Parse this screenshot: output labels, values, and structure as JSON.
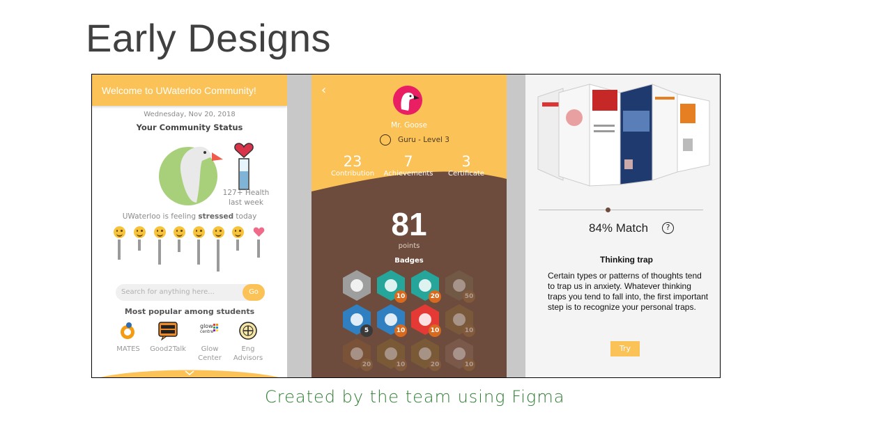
{
  "slide": {
    "title": "Early Designs",
    "caption": "Created by the team using Figma"
  },
  "community": {
    "header": "Welcome to UWaterloo Community!",
    "date": "Wednesday, Nov 20, 2018",
    "status_title": "Your Community Status",
    "health_line1": "127+ Health",
    "health_line2": "last week",
    "feeling_prefix": "UWaterloo is feeling ",
    "feeling_word": "stressed",
    "feeling_suffix": " today",
    "moods": [
      {
        "icon": "smile-emoji-icon",
        "level": 0.55
      },
      {
        "icon": "wink-emoji-icon",
        "level": 0.3
      },
      {
        "icon": "sad-emoji-icon",
        "level": 0.7
      },
      {
        "icon": "grin-emoji-icon",
        "level": 0.35
      },
      {
        "icon": "neutral-emoji-icon",
        "level": 0.7
      },
      {
        "icon": "stressed-emoji-icon",
        "level": 0.88
      },
      {
        "icon": "grimace-emoji-icon",
        "level": 0.3
      },
      {
        "icon": "heart-icon",
        "level": 0.5
      }
    ],
    "search_placeholder": "Search for anything here...",
    "go_label": "Go",
    "popular_title": "Most popular among students",
    "resources": [
      {
        "icon": "mates-logo-icon",
        "line1": "MATES",
        "line2": ""
      },
      {
        "icon": "good2talk-logo-icon",
        "line1": "Good2Talk",
        "line2": ""
      },
      {
        "icon": "glow-centre-logo-icon",
        "line1": "Glow",
        "line2": "Center"
      },
      {
        "icon": "eng-advisors-logo-icon",
        "line1": "Eng",
        "line2": "Advisors"
      }
    ],
    "colors": {
      "accent": "#fbc257",
      "goose_green": "#a8d07a",
      "heart": "#d9334a"
    }
  },
  "profile": {
    "back_icon": "chevron-left-icon",
    "avatar_icon": "goose-avatar-icon",
    "name": "Mr. Goose",
    "level": "Guru - Level 3",
    "stats": [
      {
        "value": "23",
        "label": "Contribution"
      },
      {
        "value": "7",
        "label": "Achievements"
      },
      {
        "value": "3",
        "label": "Certificate"
      }
    ],
    "points": "81",
    "points_label": "points",
    "badges_label": "Badges",
    "badges": [
      {
        "icon": "cherry-badge-icon",
        "count": "",
        "color": "#9e9e9e",
        "dim": false
      },
      {
        "icon": "cockatoo-badge-icon",
        "count": "10",
        "color": "#26a69a",
        "dim": false
      },
      {
        "icon": "cockatoo-badge-icon",
        "count": "20",
        "color": "#26a69a",
        "dim": false
      },
      {
        "icon": "squirrel-badge-icon",
        "count": "50",
        "color": "#7a6a4f",
        "dim": true
      },
      {
        "icon": "ballot-badge-icon",
        "count": "5",
        "color": "#2f7fc1",
        "dim": false
      },
      {
        "icon": "ballot-badge-icon",
        "count": "10",
        "color": "#2f7fc1",
        "dim": false
      },
      {
        "icon": "trophy-badge-icon",
        "count": "10",
        "color": "#e53935",
        "dim": false
      },
      {
        "icon": "teacher-badge-icon",
        "count": "10",
        "color": "#8a6a3a",
        "dim": true
      },
      {
        "icon": "person-badge-icon",
        "count": "20",
        "color": "#8a5a30",
        "dim": true
      },
      {
        "icon": "clown-badge-icon",
        "count": "10",
        "color": "#8a6a30",
        "dim": true
      },
      {
        "icon": "clown-badge-icon",
        "count": "20",
        "color": "#8a6a30",
        "dim": true
      },
      {
        "icon": "professor-badge-icon",
        "count": "10",
        "color": "#8a6a5a",
        "dim": true
      }
    ],
    "colors": {
      "header": "#fbc257",
      "body": "#6d4c3d",
      "badge_count": "#d86a1f"
    }
  },
  "trap": {
    "match": "84% Match",
    "match_level": 0.84,
    "help_icon": "question-circle-icon",
    "title": "Thinking trap",
    "body": "Certain types or patterns of thoughts tend to trap us in anxiety. Whatever thinking traps you tend to fall into, the first important step is to recognize your personal traps.",
    "try_label": "Try",
    "image_icon": "brochure-pages-icon"
  }
}
